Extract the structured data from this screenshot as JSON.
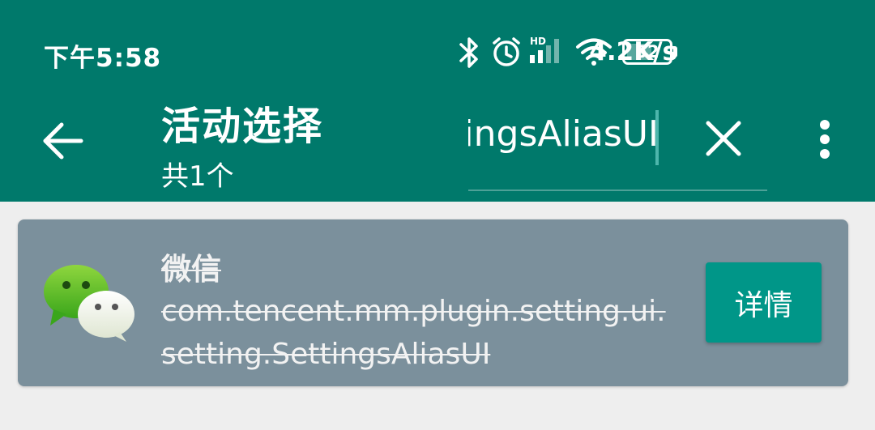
{
  "status_bar": {
    "time": "下午5:58",
    "network_speed": "4.2K/s",
    "signal_label": "HD",
    "battery": "52",
    "icons": [
      "bluetooth-icon",
      "alarm-icon",
      "signal-icon",
      "wifi-icon",
      "battery-icon"
    ]
  },
  "toolbar": {
    "title": "活动选择",
    "subtitle": "共1个",
    "search_value": "SettingsAliasUI",
    "background": "#00796b",
    "accent": "#4db6ac"
  },
  "results": [
    {
      "app_name": "微信",
      "activity": "com.tencent.mm.plugin.setting.ui.setting.SettingsAliasUI",
      "button_label": "详情",
      "icon": "wechat-icon"
    }
  ]
}
